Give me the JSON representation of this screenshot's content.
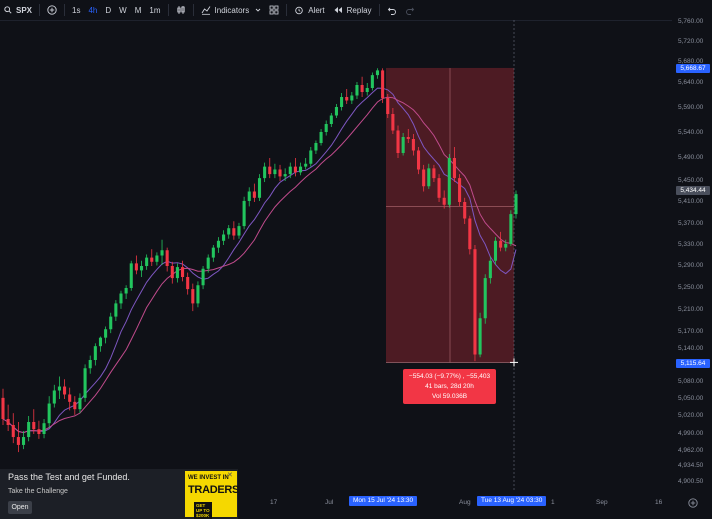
{
  "toolbar": {
    "symbol": "SPX",
    "intervals": [
      "1s",
      "4h",
      "D",
      "W",
      "M",
      "1m"
    ],
    "active_interval": "4h",
    "indicators_label": "Indicators",
    "alert_label": "Alert",
    "replay_label": "Replay"
  },
  "price_axis": {
    "labels": [
      "5,760.00",
      "5,720.00",
      "5,680.00",
      "5,640.00",
      "5,590.00",
      "5,540.00",
      "5,490.00",
      "5,450.00",
      "5,410.00",
      "5,370.00",
      "5,330.00",
      "5,290.00",
      "5,250.00",
      "5,210.00",
      "5,170.00",
      "5,140.00",
      "5,080.00",
      "5,050.00",
      "5,020.00",
      "4,990.00",
      "4,962.00",
      "4,934.50",
      "4,900.50"
    ],
    "tag_top": "5,668.67",
    "tag_current": "5,434.44",
    "tag_bottom": "5,115.64"
  },
  "time_axis": {
    "labels": [
      "17",
      "Jul",
      "Aug",
      "1",
      "Sep",
      "16"
    ],
    "tag_start": "Mon 15 Jul '24    13:30",
    "tag_end": "Tue 13 Aug '24    03:30"
  },
  "measure": {
    "line1": "−554.03 (−9.77%) , −55,403",
    "line2": "41 bars, 28d 20h",
    "line3": "Vol 59.036B"
  },
  "ad": {
    "title": "Pass the Test and get Funded.",
    "subtitle": "Take the Challenge",
    "button": "Open",
    "logo_line1": "WE INVEST IN",
    "logo_line2": "TRADERS",
    "logo_line3": "GET UP TO $200K"
  },
  "colors": {
    "up": "#22c55e",
    "down": "#f23645",
    "ma1": "#7e57c2",
    "ma2": "#c04b8c",
    "accent": "#2962ff",
    "range_fill": "#f23645"
  },
  "candles": [
    [
      5052,
      5068,
      5015,
      5005
    ],
    [
      5015,
      5040,
      5005,
      4995
    ],
    [
      5005,
      5025,
      4985,
      4975
    ],
    [
      4985,
      5010,
      4972,
      4960
    ],
    [
      4972,
      4995,
      4985,
      4965
    ],
    [
      4985,
      5020,
      5010,
      4978
    ],
    [
      5010,
      5032,
      4998,
      4990
    ],
    [
      4998,
      5012,
      4990,
      4982
    ],
    [
      4990,
      5015,
      5008,
      4983
    ],
    [
      5008,
      5055,
      5042,
      5000
    ],
    [
      5042,
      5075,
      5065,
      5035
    ],
    [
      5065,
      5090,
      5072,
      5050
    ],
    [
      5072,
      5085,
      5058,
      5050
    ],
    [
      5058,
      5070,
      5045,
      5030
    ],
    [
      5045,
      5055,
      5032,
      5022
    ],
    [
      5032,
      5060,
      5052,
      5025
    ],
    [
      5052,
      5112,
      5105,
      5045
    ],
    [
      5105,
      5128,
      5120,
      5095
    ],
    [
      5120,
      5150,
      5145,
      5110
    ],
    [
      5145,
      5162,
      5160,
      5135
    ],
    [
      5160,
      5180,
      5175,
      5150
    ],
    [
      5175,
      5205,
      5198,
      5168
    ],
    [
      5198,
      5228,
      5222,
      5190
    ],
    [
      5222,
      5245,
      5240,
      5212
    ],
    [
      5240,
      5255,
      5250,
      5230
    ],
    [
      5250,
      5300,
      5295,
      5245
    ],
    [
      5295,
      5310,
      5282,
      5275
    ],
    [
      5282,
      5300,
      5290,
      5270
    ],
    [
      5290,
      5312,
      5306,
      5283
    ],
    [
      5306,
      5322,
      5298,
      5290
    ],
    [
      5298,
      5316,
      5310,
      5291
    ],
    [
      5310,
      5340,
      5320,
      5292
    ],
    [
      5320,
      5325,
      5290,
      5280
    ],
    [
      5290,
      5298,
      5268,
      5258
    ],
    [
      5268,
      5295,
      5288,
      5260
    ],
    [
      5288,
      5300,
      5270,
      5262
    ],
    [
      5270,
      5278,
      5248,
      5238
    ],
    [
      5248,
      5258,
      5222,
      5208
    ],
    [
      5222,
      5262,
      5255,
      5215
    ],
    [
      5255,
      5290,
      5285,
      5248
    ],
    [
      5285,
      5312,
      5306,
      5278
    ],
    [
      5306,
      5330,
      5325,
      5298
    ],
    [
      5325,
      5345,
      5338,
      5315
    ],
    [
      5338,
      5358,
      5350,
      5330
    ],
    [
      5350,
      5368,
      5362,
      5342
    ],
    [
      5362,
      5375,
      5348,
      5340
    ],
    [
      5348,
      5372,
      5366,
      5342
    ],
    [
      5366,
      5420,
      5412,
      5360
    ],
    [
      5412,
      5438,
      5430,
      5402
    ],
    [
      5430,
      5445,
      5418,
      5410
    ],
    [
      5418,
      5462,
      5455,
      5412
    ],
    [
      5455,
      5482,
      5475,
      5448
    ],
    [
      5475,
      5490,
      5462,
      5455
    ],
    [
      5462,
      5480,
      5470,
      5455
    ],
    [
      5470,
      5478,
      5458,
      5450
    ],
    [
      5458,
      5472,
      5462,
      5450
    ],
    [
      5462,
      5482,
      5475,
      5455
    ],
    [
      5475,
      5490,
      5465,
      5458
    ],
    [
      5465,
      5482,
      5475,
      5460
    ],
    [
      5475,
      5490,
      5480,
      5470
    ],
    [
      5480,
      5512,
      5505,
      5475
    ],
    [
      5505,
      5525,
      5520,
      5498
    ],
    [
      5520,
      5548,
      5542,
      5515
    ],
    [
      5542,
      5565,
      5558,
      5535
    ],
    [
      5558,
      5580,
      5575,
      5552
    ],
    [
      5575,
      5598,
      5592,
      5570
    ],
    [
      5592,
      5620,
      5612,
      5585
    ],
    [
      5612,
      5628,
      5605,
      5598
    ],
    [
      5605,
      5622,
      5615,
      5598
    ],
    [
      5615,
      5642,
      5636,
      5608
    ],
    [
      5636,
      5652,
      5622,
      5612
    ],
    [
      5622,
      5640,
      5630,
      5615
    ],
    [
      5630,
      5660,
      5655,
      5625
    ],
    [
      5655,
      5668,
      5664,
      5648
    ],
    [
      5664,
      5668,
      5610,
      5600
    ],
    [
      5610,
      5618,
      5578,
      5570
    ],
    [
      5578,
      5590,
      5545,
      5538
    ],
    [
      5545,
      5555,
      5500,
      5490
    ],
    [
      5500,
      5540,
      5532,
      5495
    ],
    [
      5532,
      5548,
      5528,
      5520
    ],
    [
      5528,
      5538,
      5505,
      5495
    ],
    [
      5505,
      5512,
      5470,
      5462
    ],
    [
      5470,
      5478,
      5440,
      5430
    ],
    [
      5440,
      5480,
      5472,
      5435
    ],
    [
      5472,
      5478,
      5455,
      5448
    ],
    [
      5455,
      5462,
      5418,
      5410
    ],
    [
      5418,
      5432,
      5405,
      5398
    ],
    [
      5405,
      5498,
      5490,
      5400
    ],
    [
      5490,
      5512,
      5455,
      5448
    ],
    [
      5455,
      5462,
      5410,
      5402
    ],
    [
      5410,
      5418,
      5380,
      5370
    ],
    [
      5380,
      5385,
      5322,
      5312
    ],
    [
      5322,
      5330,
      5130,
      5118
    ],
    [
      5130,
      5205,
      5195,
      5125
    ],
    [
      5195,
      5275,
      5268,
      5185
    ],
    [
      5268,
      5308,
      5300,
      5258
    ],
    [
      5300,
      5345,
      5338,
      5292
    ],
    [
      5338,
      5355,
      5325,
      5318
    ],
    [
      5325,
      5340,
      5332,
      5318
    ],
    [
      5332,
      5395,
      5388,
      5328
    ],
    [
      5388,
      5432,
      5425,
      5380
    ]
  ]
}
